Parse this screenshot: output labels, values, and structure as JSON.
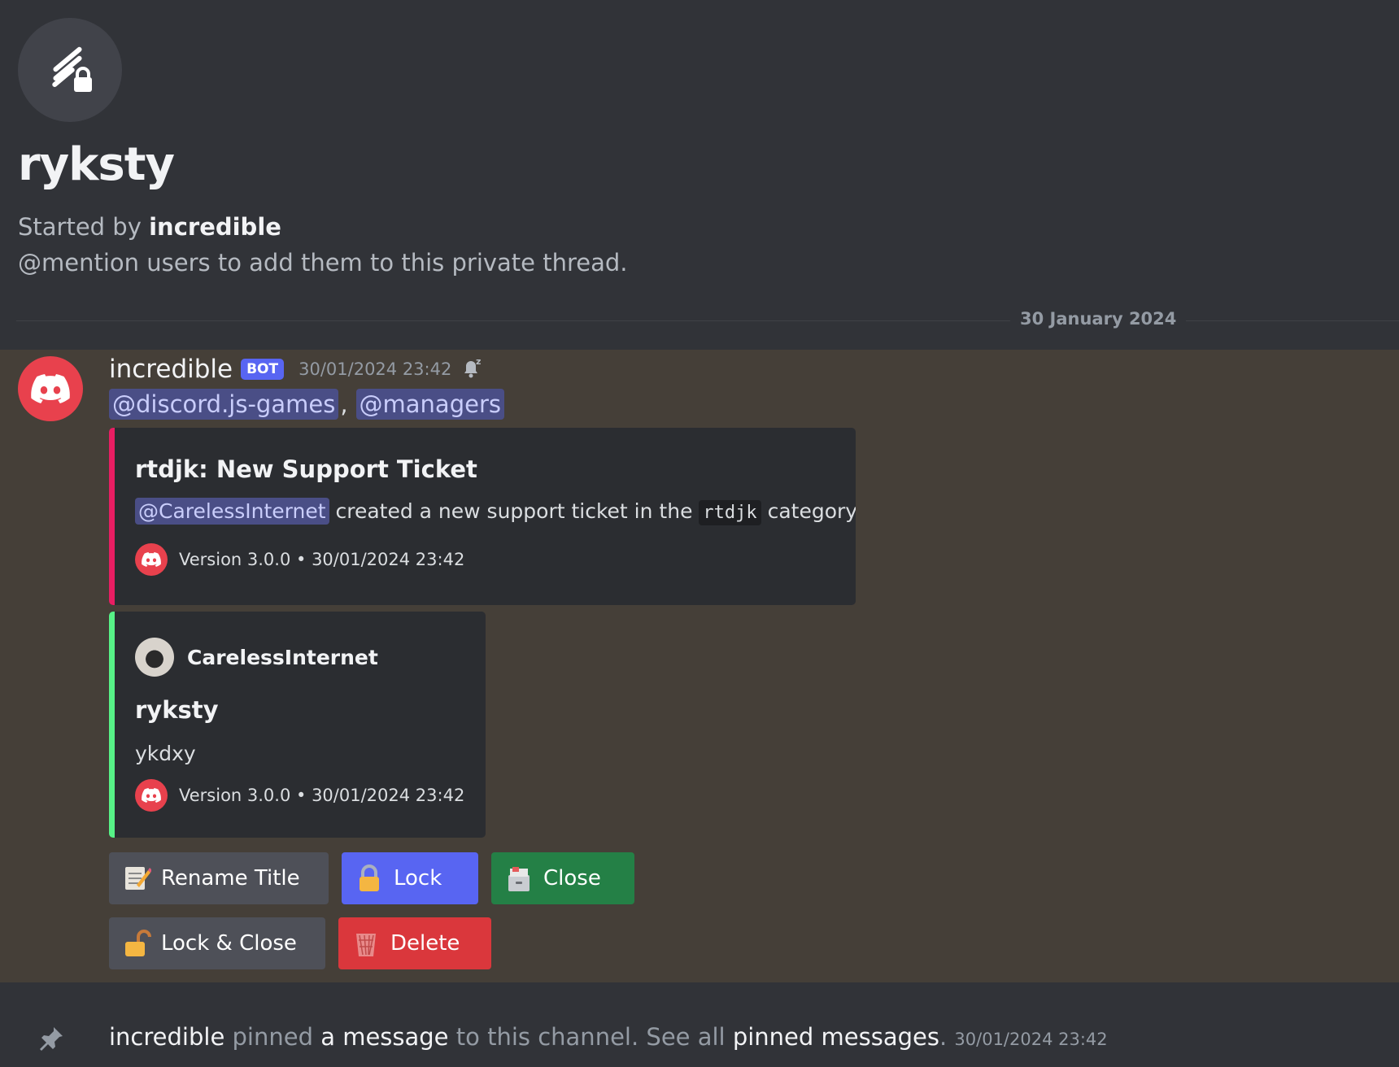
{
  "thread": {
    "title": "ryksty",
    "started_prefix": "Started by",
    "started_user": "incredible",
    "hint": "@mention users to add them to this private thread.",
    "date_divider": "30 January 2024"
  },
  "message": {
    "author": "incredible",
    "bot_tag": "BOT",
    "timestamp": "30/01/2024 23:42",
    "mentions": [
      "@discord.js-games",
      "@managers"
    ],
    "mention_separator": ","
  },
  "embed1": {
    "accent": "#e91e63",
    "title": "rtdjk: New Support Ticket",
    "desc_mention": "@CarelessInternet",
    "desc_text1": "created a new support ticket in the",
    "desc_code": "rtdjk",
    "desc_text2": "category!",
    "footer": "Version 3.0.0 • 30/01/2024 23:42"
  },
  "embed2": {
    "accent": "#57f287",
    "author": "CarelessInternet",
    "title": "ryksty",
    "desc": "ykdxy",
    "footer": "Version 3.0.0 • 30/01/2024 23:42"
  },
  "buttons": {
    "rename": "Rename Title",
    "lock": "Lock",
    "close": "Close",
    "lock_close": "Lock & Close",
    "delete": "Delete"
  },
  "system": {
    "user": "incredible",
    "t1": "pinned",
    "link1": "a message",
    "t2": "to this channel. See all",
    "link2": "pinned messages",
    "t3": ".",
    "timestamp": "30/01/2024 23:42"
  }
}
